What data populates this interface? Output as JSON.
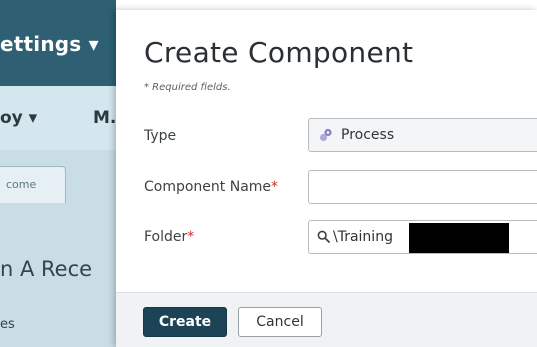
{
  "background": {
    "settings_menu": "ettings ▾",
    "nav_item_1": "oy ▾",
    "nav_item_2": "M.",
    "tab_label": "come",
    "headline": "n A Rece",
    "subline": "es"
  },
  "dialog": {
    "title": "Create Component",
    "required_note": "* Required fields.",
    "fields": {
      "type": {
        "label": "Type",
        "value": "Process",
        "icon": "process-icon"
      },
      "component_name": {
        "label": "Component Name",
        "required_mark": "*",
        "value": ""
      },
      "folder": {
        "label": "Folder",
        "required_mark": "*",
        "value": "\\Training",
        "icon": "search-icon"
      }
    },
    "buttons": {
      "create": "Create",
      "cancel": "Cancel"
    }
  },
  "colors": {
    "topbar": "#2f5f73",
    "primary_button": "#1c4456",
    "required": "#c9302c"
  }
}
